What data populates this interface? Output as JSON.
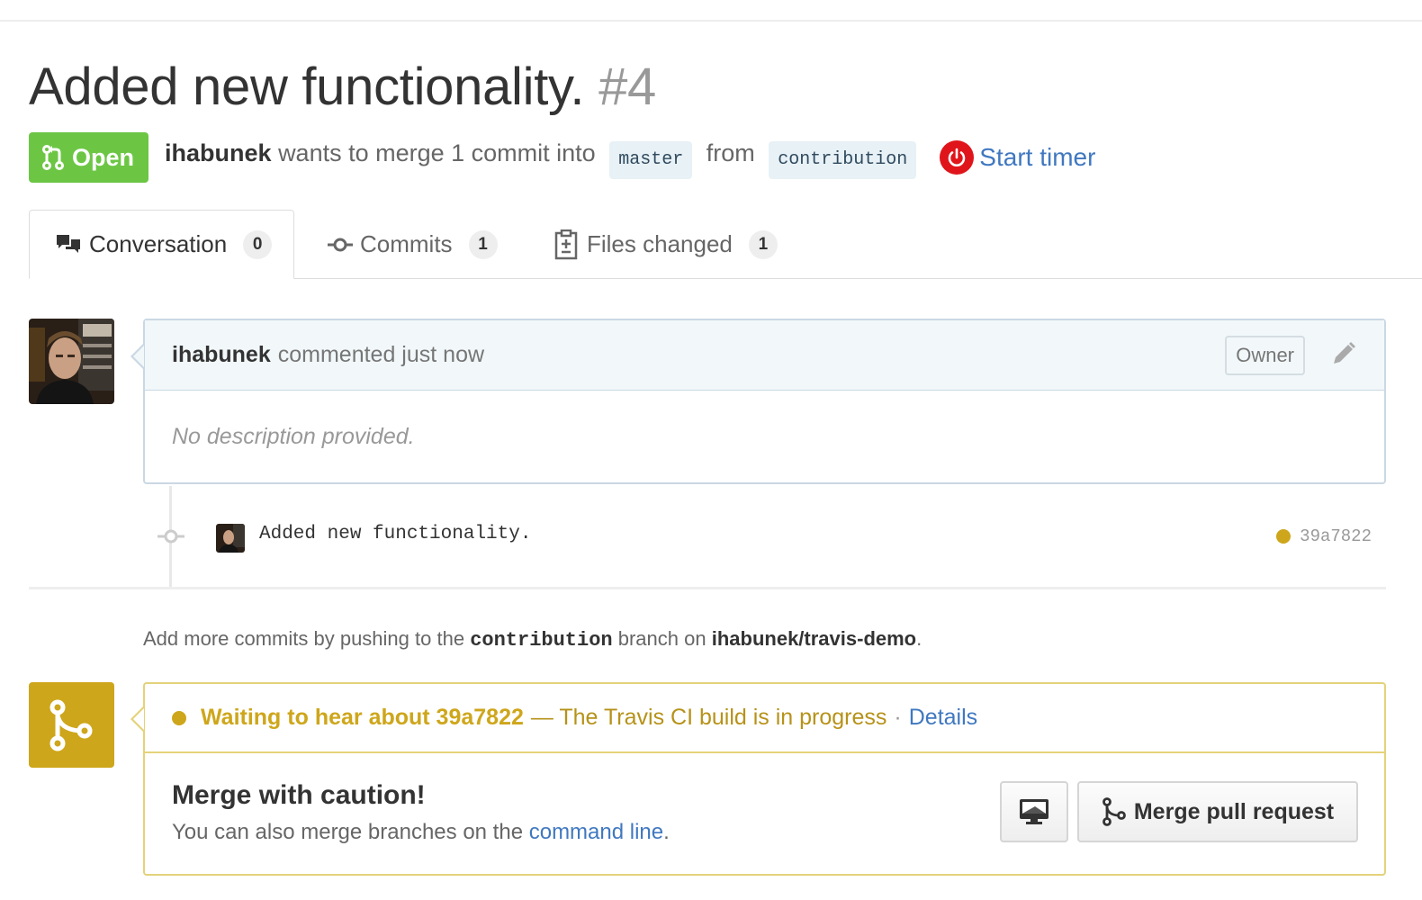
{
  "pull_request": {
    "title": "Added new functionality.",
    "number": "#4",
    "state": "Open",
    "author": "ihabunek",
    "merge_text_1": "wants to merge 1 commit into",
    "base_branch": "master",
    "merge_text_2": "from",
    "head_branch": "contribution",
    "timer_label": "Start timer"
  },
  "tabs": [
    {
      "label": "Conversation",
      "count": "0",
      "icon": "comment-discussion-icon",
      "selected": true
    },
    {
      "label": "Commits",
      "count": "1",
      "icon": "git-commit-icon",
      "selected": false
    },
    {
      "label": "Files changed",
      "count": "1",
      "icon": "diff-icon",
      "selected": false
    }
  ],
  "comment": {
    "author": "ihabunek",
    "action": "commented just now",
    "role_badge": "Owner",
    "body": "No description provided."
  },
  "commit": {
    "message": "Added new functionality.",
    "sha": "39a7822",
    "status_color": "#cea61b"
  },
  "hint": {
    "prefix": "Add more commits by pushing to the",
    "branch": "contribution",
    "middle": "branch on",
    "repo": "ihabunek/travis-demo",
    "suffix": "."
  },
  "merge_status": {
    "headline": "Waiting to hear about 39a7822",
    "description": "— The Travis CI build is in progress",
    "separator": "·",
    "details_link": "Details",
    "title": "Merge with caution!",
    "subtitle_prefix": "You can also merge branches on the",
    "subtitle_link": "command line",
    "subtitle_suffix": ".",
    "merge_button": "Merge pull request",
    "cli_icon": "desktop-icon"
  },
  "colors": {
    "open_green": "#6cc644",
    "pending_yellow": "#cea61b",
    "link_blue": "#4078c0",
    "timer_red": "#e0151b"
  }
}
